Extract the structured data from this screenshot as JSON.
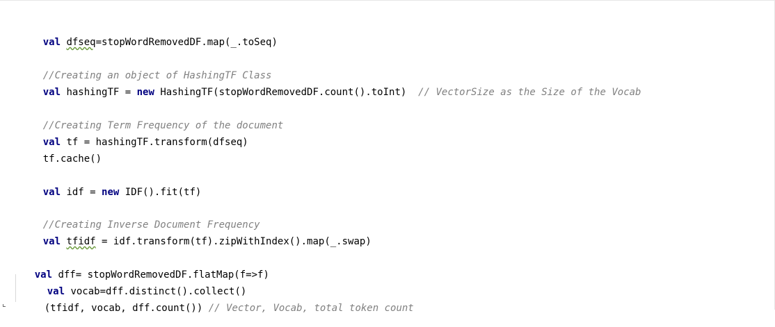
{
  "editor": {
    "lines": [
      {
        "kw": "val",
        "rest": " dfseq=stopWordRemovedDF.map(_.toSeq)",
        "squiggle": "dfseq"
      },
      {
        "comment": "//Creating an object of HashingTF Class"
      },
      {
        "kw": "val",
        "pre": " hashingTF = ",
        "kw2": "new",
        "rest": " HashingTF(stopWordRemovedDF.count().toInt)",
        "comment": "  // VectorSize as the Size of the Vocab"
      },
      {
        "comment": "//Creating Term Frequency of the document"
      },
      {
        "kw": "val",
        "rest": " tf = hashingTF.transform(dfseq)"
      },
      {
        "rest": "tf.cache()"
      },
      {
        "kw": "val",
        "pre": " idf = ",
        "kw2": "new",
        "rest": " IDF().fit(tf)"
      },
      {
        "comment": "//Creating Inverse Document Frequency"
      },
      {
        "kw": "val",
        "rest": " tfidf = idf.transform(tf).zipWithIndex().map(_.swap)",
        "squiggle": "tfidf"
      },
      {
        "kw": "val",
        "rest": " dff= stopWordRemovedDF.flatMap(f=>f)"
      },
      {
        "kw": "val",
        "rest": " vocab=dff.distinct().collect()"
      },
      {
        "rest": "(tfidf, vocab, dff.count())",
        "comment": " // Vector, Vocab, total token count"
      }
    ]
  },
  "colors": {
    "keyword": "#000080",
    "comment": "#808080",
    "text": "#000000",
    "background": "#ffffff"
  }
}
